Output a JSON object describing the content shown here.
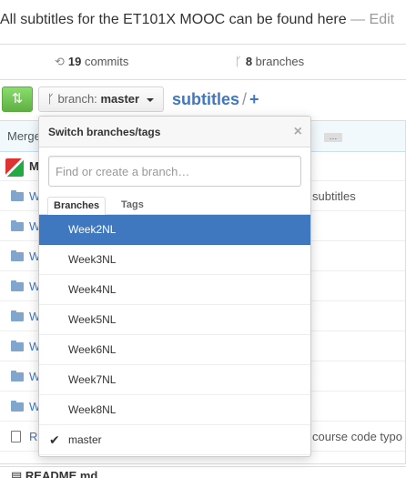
{
  "repo": {
    "description": "All subtitles for the ET101X MOOC can be found here",
    "edit_link": "— Edit",
    "commits_count": "19",
    "commits_label": "commits",
    "branches_count": "8",
    "branches_label": "branches",
    "current_branch_prefix": "branch:",
    "current_branch": "master",
    "breadcrumb_root": "subtitles",
    "breadcrumb_sep": "/",
    "breadcrumb_plus": "+"
  },
  "commit_tease": {
    "message_prefix": "Merge",
    "author_initial": "M"
  },
  "files": [
    {
      "name": "W",
      "message": "subtitles"
    },
    {
      "name": "W",
      "message": ""
    },
    {
      "name": "W",
      "message": ""
    },
    {
      "name": "W",
      "message": ""
    },
    {
      "name": "W",
      "message": ""
    },
    {
      "name": "W",
      "message": ""
    },
    {
      "name": "W",
      "message": ""
    },
    {
      "name": "W",
      "message": ""
    },
    {
      "name": "RI",
      "message": "course code typo"
    }
  ],
  "readme_heading": "README.md",
  "dropdown": {
    "title": "Switch branches/tags",
    "close": "×",
    "filter_placeholder": "Find or create a branch…",
    "tab_branches": "Branches",
    "tab_tags": "Tags",
    "items": [
      "Week2NL",
      "Week3NL",
      "Week4NL",
      "Week5NL",
      "Week6NL",
      "Week7NL",
      "Week8NL",
      "master"
    ],
    "highlighted": "Week2NL",
    "selected": "master"
  },
  "colors": {
    "accent": "#4078c0",
    "compare_green": "#60b044"
  },
  "icons": {
    "commits": "history-icon",
    "branches": "git-branch-icon",
    "compare": "compare-icon",
    "folder": "folder-icon",
    "file": "file-icon",
    "check": "check-icon"
  }
}
